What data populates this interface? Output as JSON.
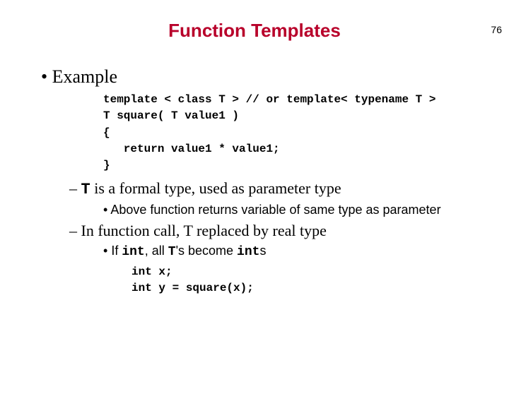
{
  "page_number": "76",
  "title": "Function Templates",
  "bullet1": "Example",
  "code1": "template < class T > // or template< typename T >\nT square( T value1 )\n{\n   return value1 * value1;\n}",
  "dash1_pre": "T",
  "dash1_post": " is a formal type, used as parameter type",
  "sub1": "Above function returns variable of same type as parameter",
  "dash2": "In function call, T replaced by real type",
  "sub2_a": "If ",
  "sub2_b": "int",
  "sub2_c": ", all ",
  "sub2_d": "T",
  "sub2_e": "'s become ",
  "sub2_f": "int",
  "sub2_g": "s",
  "code2": "int x;\nint y = square(x);"
}
